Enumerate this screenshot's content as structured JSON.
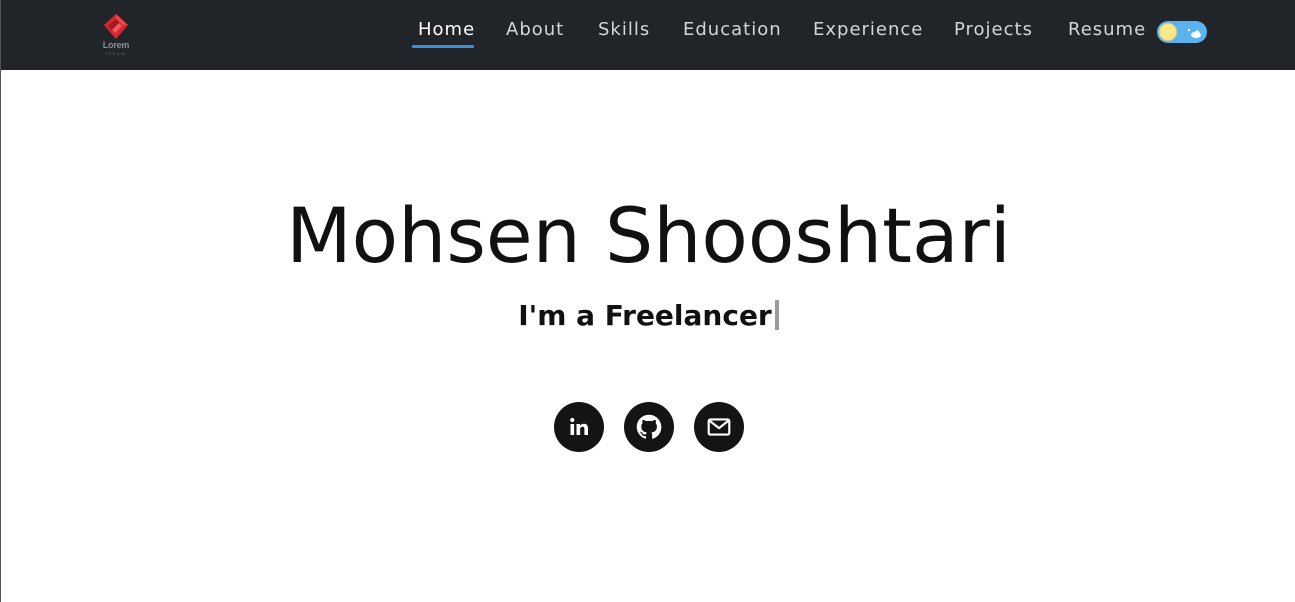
{
  "logo": {
    "text": "Lorem",
    "subtext": "IPSUM"
  },
  "nav": {
    "items": [
      {
        "label": "Home",
        "active": true
      },
      {
        "label": "About",
        "active": false
      },
      {
        "label": "Skills",
        "active": false
      },
      {
        "label": "Education",
        "active": false
      },
      {
        "label": "Experience",
        "active": false
      },
      {
        "label": "Projects",
        "active": false
      },
      {
        "label": "Resume",
        "active": false
      }
    ],
    "accent_color": "#3d8fdc"
  },
  "theme_toggle": {
    "mode": "light",
    "icons": [
      "sun-icon",
      "cloud-icon"
    ]
  },
  "hero": {
    "name": "Mohsen Shooshtari",
    "tagline_prefix": "I'm a ",
    "tagline_role": "Freelancer"
  },
  "socials": [
    {
      "icon": "linkedin-icon",
      "label": "LinkedIn"
    },
    {
      "icon": "github-icon",
      "label": "GitHub"
    },
    {
      "icon": "mail-icon",
      "label": "Email"
    }
  ],
  "colors": {
    "navbar_bg": "#212428",
    "text": "#111111",
    "toggle_bg": "#5ab3ee",
    "sun": "#fbe88a",
    "logo_red": "#d7262c"
  }
}
